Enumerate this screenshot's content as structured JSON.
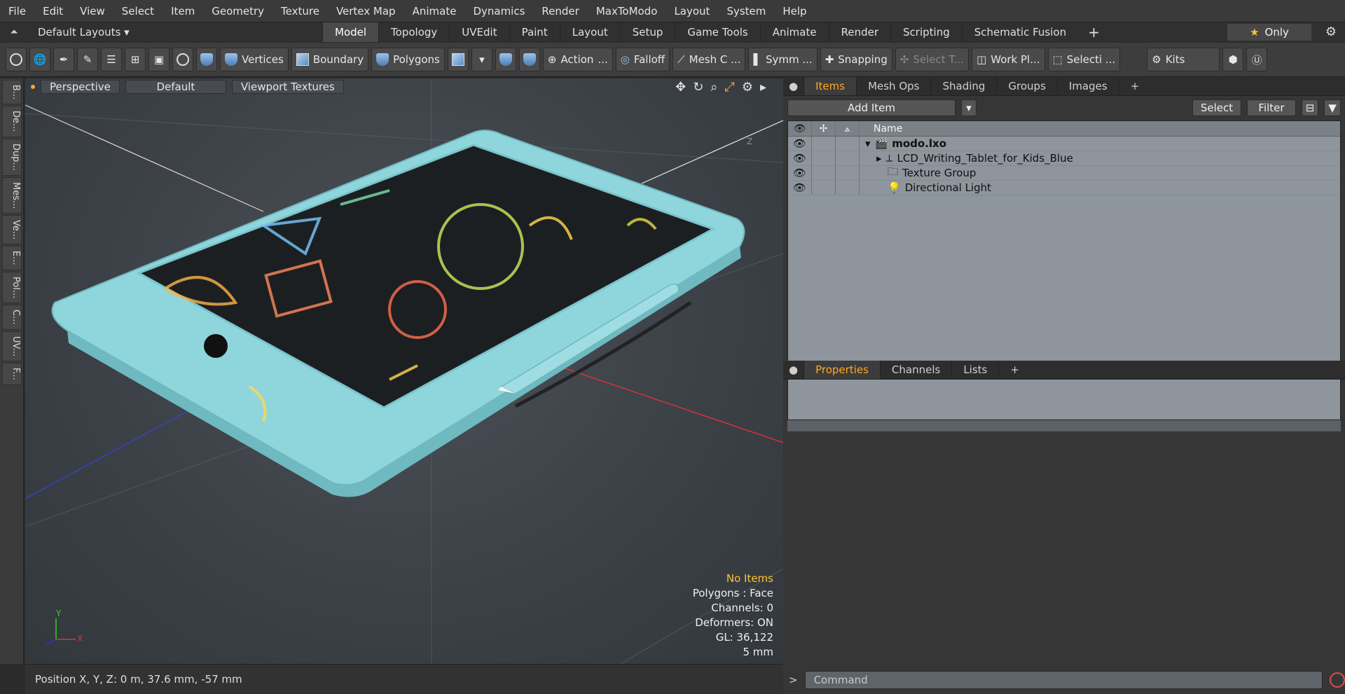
{
  "menu": [
    "File",
    "Edit",
    "View",
    "Select",
    "Item",
    "Geometry",
    "Texture",
    "Vertex Map",
    "Animate",
    "Dynamics",
    "Render",
    "MaxToModo",
    "Layout",
    "System",
    "Help"
  ],
  "layout": {
    "name": "Default Layouts",
    "tabs": [
      "Model",
      "Topology",
      "UVEdit",
      "Paint",
      "Layout",
      "Setup",
      "Game Tools",
      "Animate",
      "Render",
      "Scripting",
      "Schematic Fusion"
    ],
    "active_tab": "Model",
    "only_label": "Only"
  },
  "toolbar": {
    "vertices": "Vertices",
    "boundary": "Boundary",
    "polygons": "Polygons",
    "action": "Action",
    "action_more": "...",
    "falloff": "Falloff",
    "mesh": "Mesh C ...",
    "symm": "Symm ...",
    "snapping": "Snapping",
    "select_t": "Select T...",
    "work_pl": "Work Pl...",
    "selecti": "Selecti ...",
    "kits": "Kits"
  },
  "left_strip": [
    "B...",
    "De...",
    "Dup...",
    "Mes...",
    "Ve...",
    "E...",
    "Pol...",
    "C...",
    "UV...",
    "F..."
  ],
  "viewport": {
    "view": "Perspective",
    "shading": "Default",
    "textures": "Viewport Textures",
    "hud": {
      "items": "No Items",
      "polygons": "Polygons : Face",
      "channels": "Channels: 0",
      "deformers": "Deformers: ON",
      "gl": "GL: 36,122",
      "unit": "5 mm"
    },
    "gizmo": {
      "y": "Y",
      "x": "X"
    },
    "axis_label": "Z"
  },
  "status": {
    "position": "Position X, Y, Z:  0 m, 37.6 mm, -57 mm"
  },
  "items_panel": {
    "tabs": [
      "Items",
      "Mesh Ops",
      "Shading",
      "Groups",
      "Images"
    ],
    "active_tab": "Items",
    "add_item": "Add Item",
    "select": "Select",
    "filter": "Filter",
    "name_header": "Name",
    "rows": [
      {
        "name": "modo.lxo",
        "bold": true
      },
      {
        "name": "LCD_Writing_Tablet_for_Kids_Blue"
      },
      {
        "name": "Texture Group"
      },
      {
        "name": "Directional Light"
      }
    ]
  },
  "properties_panel": {
    "tabs": [
      "Properties",
      "Channels",
      "Lists"
    ],
    "active_tab": "Properties"
  },
  "command": {
    "placeholder": "Command",
    "prompt": ">"
  },
  "colors": {
    "accent": "#ffa726",
    "star": "#ffc233",
    "tablet": "#8fd6dc",
    "axis_x": "#d33",
    "axis_y": "#3c3",
    "axis_z": "#33d"
  }
}
